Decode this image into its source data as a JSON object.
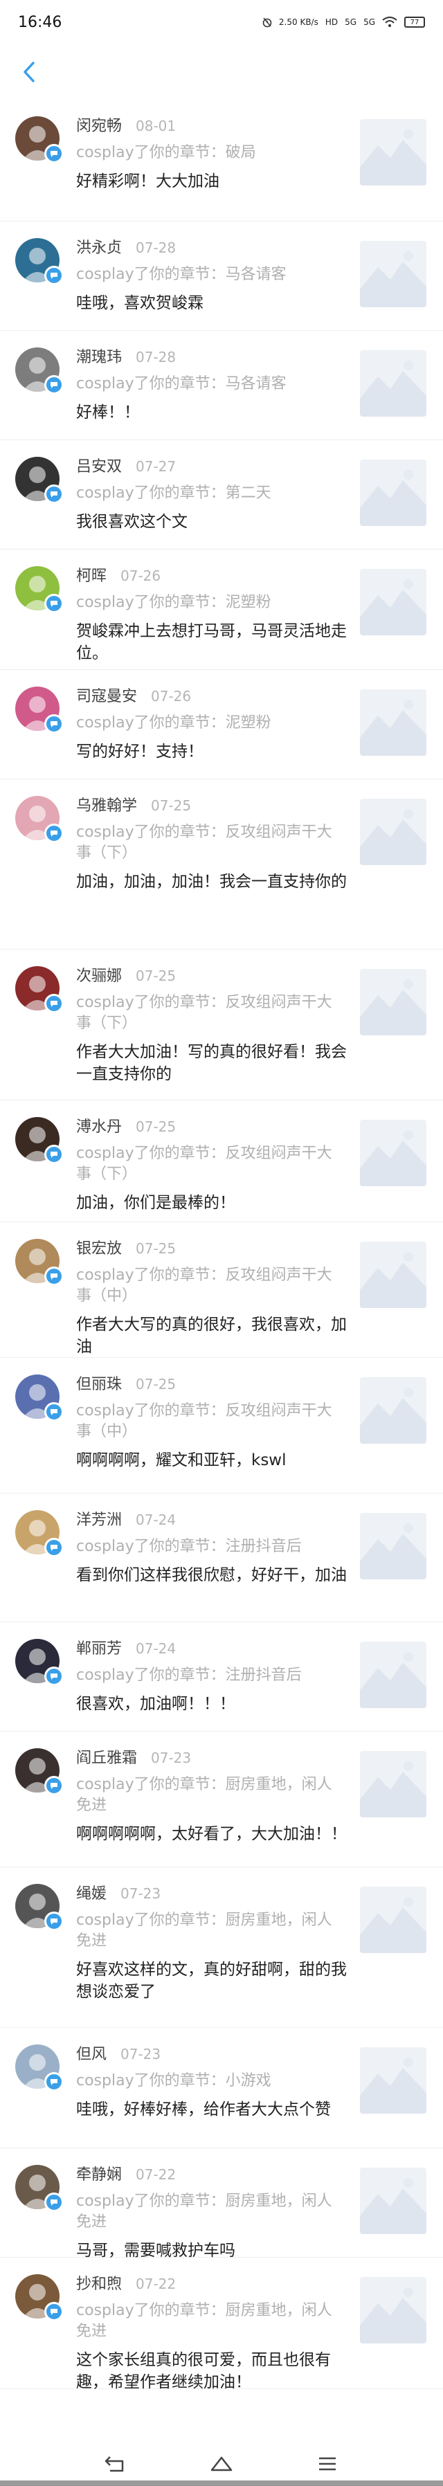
{
  "status_bar": {
    "time": "16:46",
    "net_speed": "2.50 KB/s",
    "hd_label": "HD",
    "signal_a": "5G",
    "signal_b": "5G",
    "battery": "77"
  },
  "colors": {
    "accent": "#3a9fe8",
    "thumb_bg": "#eef1f5",
    "muted": "#b0b0b0"
  },
  "comments": [
    {
      "name": "闵宛畅",
      "date": "08-01",
      "chapter": "cosplay了你的章节：破局",
      "text": "好精彩啊！大大加油",
      "avatar_color": "#6b4a3a"
    },
    {
      "name": "洪永贞",
      "date": "07-28",
      "chapter": "cosplay了你的章节：马各请客",
      "text": "哇哦，喜欢贺峻霖",
      "avatar_color": "#2d6f94"
    },
    {
      "name": "潮瑰玮",
      "date": "07-28",
      "chapter": "cosplay了你的章节：马各请客",
      "text": "好棒！！",
      "avatar_color": "#7d7d7d"
    },
    {
      "name": "吕安双",
      "date": "07-27",
      "chapter": "cosplay了你的章节：第二天",
      "text": "我很喜欢这个文",
      "avatar_color": "#333333"
    },
    {
      "name": "柯晖",
      "date": "07-26",
      "chapter": "cosplay了你的章节：泥塑粉",
      "text": "贺峻霖冲上去想打马哥，马哥灵活地走位。",
      "avatar_color": "#8fbf3f"
    },
    {
      "name": "司寇曼安",
      "date": "07-26",
      "chapter": "cosplay了你的章节：泥塑粉",
      "text": "写的好好！支持！",
      "avatar_color": "#d05a8a"
    },
    {
      "name": "乌雅翰学",
      "date": "07-25",
      "chapter": "cosplay了你的章节：反攻组闷声干大事（下）",
      "text": "加油，加油，加油！我会一直支持你的",
      "avatar_color": "#e3a6b3"
    },
    {
      "name": "次骊娜",
      "date": "07-25",
      "chapter": "cosplay了你的章节：反攻组闷声干大事（下）",
      "text": "作者大大加油！写的真的很好看！我会一直支持你的",
      "avatar_color": "#8a2a2a"
    },
    {
      "name": "溥水丹",
      "date": "07-25",
      "chapter": "cosplay了你的章节：反攻组闷声干大事（下）",
      "text": "加油，你们是最棒的！",
      "avatar_color": "#3b2a22"
    },
    {
      "name": "银宏放",
      "date": "07-25",
      "chapter": "cosplay了你的章节：反攻组闷声干大事（中）",
      "text": "作者大大写的真的很好，我很喜欢，加油",
      "avatar_color": "#b08a5a"
    },
    {
      "name": "但丽珠",
      "date": "07-25",
      "chapter": "cosplay了你的章节：反攻组闷声干大事（中）",
      "text": "啊啊啊啊，耀文和亚轩，kswl",
      "avatar_color": "#5a6fb0"
    },
    {
      "name": "洋芳洲",
      "date": "07-24",
      "chapter": "cosplay了你的章节：注册抖音后",
      "text": "看到你们这样我很欣慰，好好干，加油",
      "avatar_color": "#c9a46a"
    },
    {
      "name": "郸丽芳",
      "date": "07-24",
      "chapter": "cosplay了你的章节：注册抖音后",
      "text": "很喜欢，加油啊！！！",
      "avatar_color": "#2a2a3a"
    },
    {
      "name": "阎丘雅霜",
      "date": "07-23",
      "chapter": "cosplay了你的章节：厨房重地，闲人免进",
      "text": "啊啊啊啊啊，太好看了，大大加油！！",
      "avatar_color": "#3a3030"
    },
    {
      "name": "绳媛",
      "date": "07-23",
      "chapter": "cosplay了你的章节：厨房重地，闲人免进",
      "text": "好喜欢这样的文，真的好甜啊，甜的我想谈恋爱了",
      "avatar_color": "#555555"
    },
    {
      "name": "但风",
      "date": "07-23",
      "chapter": "cosplay了你的章节：小游戏",
      "text": "哇哦，好棒好棒，给作者大大点个赞",
      "avatar_color": "#9ab0c8"
    },
    {
      "name": "牵静娴",
      "date": "07-22",
      "chapter": "cosplay了你的章节：厨房重地，闲人免进",
      "text": "马哥，需要喊救护车吗",
      "avatar_color": "#6a5a4a"
    },
    {
      "name": "抄和煦",
      "date": "07-22",
      "chapter": "cosplay了你的章节：厨房重地，闲人免进",
      "text": "这个家长组真的很可爱，而且也很有趣，希望作者继续加油！",
      "avatar_color": "#7a5a3a"
    }
  ]
}
